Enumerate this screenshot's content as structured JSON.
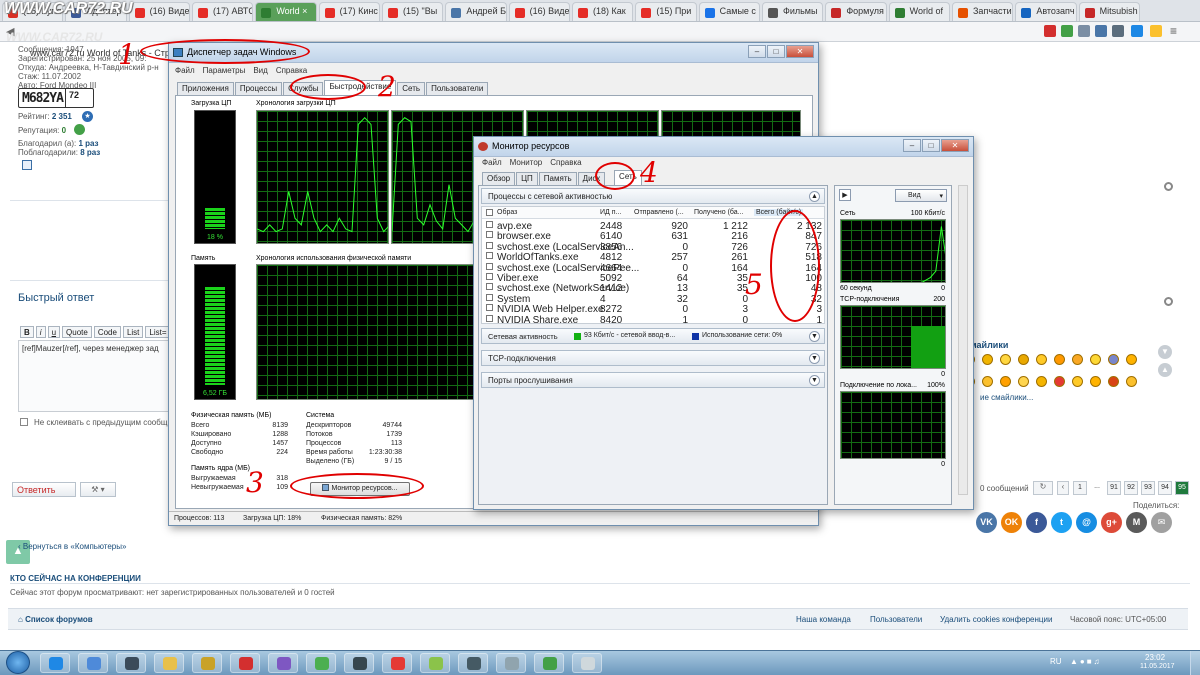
{
  "browser": {
    "tabs": [
      {
        "label": "(15) Купл",
        "color": "#d93025"
      },
      {
        "label": "Адаптер",
        "color": "#3b5998"
      },
      {
        "label": "(16) Виде",
        "color": "#e52d27"
      },
      {
        "label": "(17) АВТС",
        "color": "#e52d27"
      },
      {
        "label": "World ×",
        "color": "#2e7d32"
      },
      {
        "label": "(17) Кинс",
        "color": "#e52d27"
      },
      {
        "label": "(15) \"Вы",
        "color": "#e52d27"
      },
      {
        "label": "Андрей Б",
        "color": "#4a76a8"
      },
      {
        "label": "(16) Виде",
        "color": "#e52d27"
      },
      {
        "label": "(18) Как",
        "color": "#e52d27"
      },
      {
        "label": "(15) При",
        "color": "#e52d27"
      },
      {
        "label": "Самые с",
        "color": "#1a73e8"
      },
      {
        "label": "Фильмы",
        "color": "#555555"
      },
      {
        "label": "Формуля",
        "color": "#c62828"
      },
      {
        "label": "World of",
        "color": "#2e7d32"
      },
      {
        "label": "Запчасти",
        "color": "#e65100"
      },
      {
        "label": "Автозапч",
        "color": "#1565c0"
      },
      {
        "label": "Mitsubish",
        "color": "#c62828"
      }
    ],
    "active_tab": 4,
    "address": "www.car72.ru     World of Tanks - Страница 95 - CAR72.RU Тюменский Портал Автолюбителей Тюмень"
  },
  "forum": {
    "logo": "WWW.CAR72.RU",
    "user_info": [
      "Сообщения: 1947",
      "Зарегистрирован: 25 ноя 2005, 09:",
      "Откуда: Андреевка, Н-Тавдинский р-н",
      "Стаж: 11.07.2002",
      "Авто: Ford Mondeo III"
    ],
    "plate": "M682YA",
    "plate_region": "72",
    "rating_label": "Рейтинг:",
    "rating_value": "2 351",
    "reputation_label": "Репутация:",
    "reputation_value": "0",
    "thanked_label": "Благодарил (а):",
    "thanked_value": "1 раз",
    "thanked_by_label": "Поблагодарили:",
    "thanked_by_value": "8 раз",
    "quick_reply": "Быстрый ответ",
    "editor_buttons": [
      "B",
      "i",
      "u",
      "Quote",
      "Code",
      "List",
      "List="
    ],
    "reply_text": "[ref]Mauzer[/ref], через менеджер зад",
    "no_merge": "Не склеивать с предыдущим сообщ",
    "reply_button": "Ответить",
    "back_link": "Вернуться в «Компьютеры»",
    "who_online_title": "КТО СЕЙЧАС НА КОНФЕРЕНЦИИ",
    "who_online_text": "Сейчас этот форум просматривают: нет зарегистрированных пользователей и 0 гостей",
    "forums_list": "Список форумов",
    "footer_links": [
      "Наша команда",
      "Пользователи",
      "Удалить cookies конференции",
      "Часовой пояс: UTC+05:00"
    ],
    "smilies_title": "майлики",
    "more_smilies": "ие смайлики...",
    "messages_count": "0 сообщений",
    "pages": [
      "1",
      "...",
      "91",
      "92",
      "93",
      "94",
      "95"
    ],
    "share_label": "Поделиться:",
    "share_icons": [
      {
        "label": "VK",
        "color": "#4a76a8"
      },
      {
        "label": "OK",
        "color": "#ee8208"
      },
      {
        "label": "f",
        "color": "#3b5998"
      },
      {
        "label": "t",
        "color": "#1da1f2"
      },
      {
        "label": "@",
        "color": "#168de2"
      },
      {
        "label": "g+",
        "color": "#dd4b39"
      },
      {
        "label": "M",
        "color": "#5a5a5a"
      },
      {
        "label": "✉",
        "color": "#a0a0a0"
      }
    ]
  },
  "taskmgr": {
    "title": "Диспетчер задач Windows",
    "menu": [
      "Файл",
      "Параметры",
      "Вид",
      "Справка"
    ],
    "tabs": [
      "Приложения",
      "Процессы",
      "Службы",
      "Быстродействие",
      "Сеть",
      "Пользователи"
    ],
    "selected_tab": 3,
    "cpu_label": "Загрузка ЦП",
    "cpu_history_label": "Хронология загрузки ЦП",
    "cpu_value": "18 %",
    "cpu_percent": 18,
    "mem_label": "Память",
    "mem_history_label": "Хронология использования физической памяти",
    "mem_value": "6,52 ГБ",
    "mem_percent": 82,
    "phys_title": "Физическая память (МБ)",
    "phys": [
      [
        "Всего",
        "8139"
      ],
      [
        "Кэшировано",
        "1288"
      ],
      [
        "Доступно",
        "1457"
      ],
      [
        "Свободно",
        "224"
      ]
    ],
    "kernel_title": "Память ядра (МБ)",
    "kernel": [
      [
        "Выгружаемая",
        "318"
      ],
      [
        "Невыгружаемая",
        "109"
      ]
    ],
    "system_title": "Система",
    "system": [
      [
        "Дескрипторов",
        "49744"
      ],
      [
        "Потоков",
        "1739"
      ],
      [
        "Процессов",
        "113"
      ],
      [
        "Время работы",
        "1:23:30:38"
      ],
      [
        "Выделено (ГБ)",
        "9 / 15"
      ]
    ],
    "resmon_button": "Монитор ресурсов...",
    "status": [
      "Процессов: 113",
      "Загрузка ЦП: 18%",
      "Физическая память: 82%"
    ]
  },
  "resmon": {
    "title": "Монитор ресурсов",
    "menu": [
      "Файл",
      "Монитор",
      "Справка"
    ],
    "tabs": [
      "Обзор",
      "ЦП",
      "Память",
      "Диск",
      "Сеть"
    ],
    "selected_tab": 4,
    "section_title": "Процессы с сетевой активностью",
    "columns": [
      "Образ",
      "ИД п...",
      "Отправлено (...",
      "Получено (ба...",
      "Всего (байт/с)"
    ],
    "rows": [
      [
        "avp.exe",
        "2448",
        "920",
        "1 212",
        "2 132"
      ],
      [
        "browser.exe",
        "6140",
        "631",
        "216",
        "847"
      ],
      [
        "svchost.exe (LocalServiceAn...",
        "3856",
        "0",
        "726",
        "726"
      ],
      [
        "WorldOfTanks.exe",
        "4812",
        "257",
        "261",
        "518"
      ],
      [
        "svchost.exe (LocalServicePee...",
        "4664",
        "0",
        "164",
        "164"
      ],
      [
        "Viber.exe",
        "5092",
        "64",
        "35",
        "100"
      ],
      [
        "svchost.exe (NetworkService)",
        "1412",
        "13",
        "35",
        "48"
      ],
      [
        "System",
        "4",
        "32",
        "0",
        "32"
      ],
      [
        "NVIDIA Web Helper.exe",
        "8272",
        "0",
        "3",
        "3"
      ],
      [
        "NVIDIA Share.exe",
        "8420",
        "1",
        "0",
        "1"
      ]
    ],
    "net_activity": "Сетевая активность",
    "net_io": "93 Кбит/с - сетевой ввод-в...",
    "net_usage": "Использование сети: 0%",
    "tcp": "TCP-подключения",
    "ports": "Порты прослушивания",
    "view_button": "Вид",
    "graph_net": "Сеть",
    "graph_net_max": "100 Кбит/с",
    "graph_seconds": "60 секунд",
    "graph_zero": "0",
    "graph_tcp": "TCP-подключения",
    "graph_tcp_max": "200",
    "graph_local": "Подключение по лока...",
    "graph_local_max": "100%"
  },
  "annotations": [
    "1",
    "2",
    "3",
    "4",
    "5"
  ],
  "tray": {
    "lang": "RU",
    "time": "23:02",
    "date": "11.05.2017"
  }
}
